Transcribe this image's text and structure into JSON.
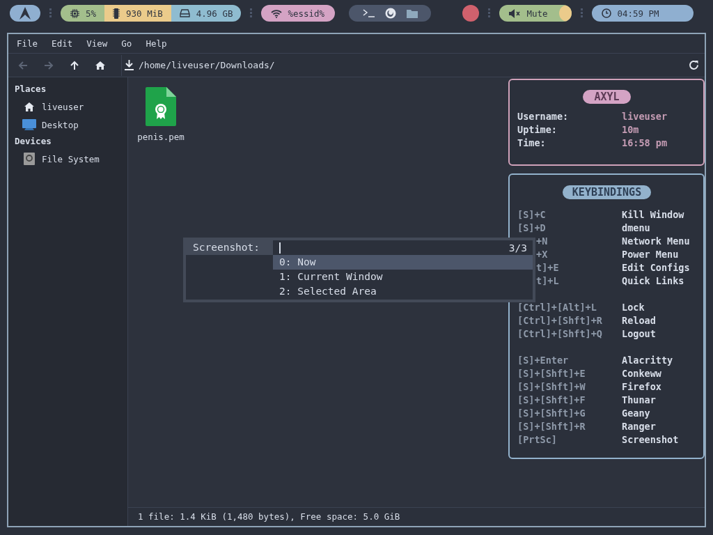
{
  "topbar": {
    "stats": [
      {
        "kind": "cpu",
        "value": "5%",
        "color": "#a3be8c"
      },
      {
        "kind": "memory",
        "value": "930 MiB",
        "color": "#ebcb8b"
      },
      {
        "kind": "disk",
        "value": "4.96 GB",
        "color": "#8fbcd0"
      }
    ],
    "wifi": "%essid%",
    "volume": "Mute",
    "clock": "04:59 PM"
  },
  "window": {
    "menu": [
      "File",
      "Edit",
      "View",
      "Go",
      "Help"
    ],
    "nav": [
      {
        "kind": "back",
        "disabled": true
      },
      {
        "kind": "forward",
        "disabled": true
      },
      {
        "kind": "up",
        "disabled": false
      },
      {
        "kind": "home",
        "disabled": false
      }
    ],
    "path": "/home/liveuser/Downloads/",
    "sidebar": [
      {
        "heading": "Places",
        "items": [
          {
            "label": "liveuser",
            "kind": "home"
          },
          {
            "label": "Desktop",
            "kind": "desktop"
          }
        ]
      },
      {
        "heading": "Devices",
        "items": [
          {
            "label": "File System",
            "kind": "drive"
          }
        ]
      }
    ],
    "files": [
      {
        "name": "penis.pem",
        "kind": "certificate"
      }
    ],
    "status": "1 file: 1.4 KiB (1,480 bytes), Free space: 5.0 GiB"
  },
  "info": {
    "title": "AXYL",
    "rows": [
      {
        "label": "Username:",
        "value": "liveuser"
      },
      {
        "label": "Uptime:",
        "value": "10m"
      },
      {
        "label": "Time:",
        "value": "16:58 pm"
      }
    ]
  },
  "keybindings": {
    "title": "KEYBINDINGS",
    "groups": [
      [
        {
          "key": "[S]+C",
          "action": "Kill Window",
          "covered": false
        },
        {
          "key": "[S]+D",
          "action": "dmenu",
          "covered": false
        },
        {
          "key": "+N",
          "action": "Network Menu",
          "covered": true
        },
        {
          "key": "+X",
          "action": "Power Menu",
          "covered": true
        },
        {
          "key": "t]+E",
          "action": "Edit Configs",
          "covered": true
        },
        {
          "key": "t]+L",
          "action": "Quick Links",
          "covered": true
        }
      ],
      [
        {
          "key": "[Ctrl]+[Alt]+L",
          "action": "Lock",
          "covered": false
        },
        {
          "key": "[Ctrl]+[Shft]+R",
          "action": "Reload",
          "covered": false
        },
        {
          "key": "[Ctrl]+[Shft]+Q",
          "action": "Logout",
          "covered": false
        }
      ],
      [
        {
          "key": "[S]+Enter",
          "action": "Alacritty",
          "covered": false
        },
        {
          "key": "[S]+[Shft]+E",
          "action": "Conkeww",
          "covered": false
        },
        {
          "key": "[S]+[Shft]+W",
          "action": "Firefox",
          "covered": false
        },
        {
          "key": "[S]+[Shft]+F",
          "action": "Thunar",
          "covered": false
        },
        {
          "key": "[S]+[Shft]+G",
          "action": "Geany",
          "covered": false
        },
        {
          "key": "[S]+[Shft]+R",
          "action": "Ranger",
          "covered": false
        },
        {
          "key": "[PrtSc]",
          "action": "Screenshot",
          "covered": false
        }
      ]
    ]
  },
  "dmenu": {
    "prompt": "Screenshot:",
    "count": "3/3",
    "options": [
      {
        "label": "0: Now",
        "selected": true
      },
      {
        "label": "1: Current Window",
        "selected": false
      },
      {
        "label": "2: Selected Area",
        "selected": false
      }
    ]
  }
}
